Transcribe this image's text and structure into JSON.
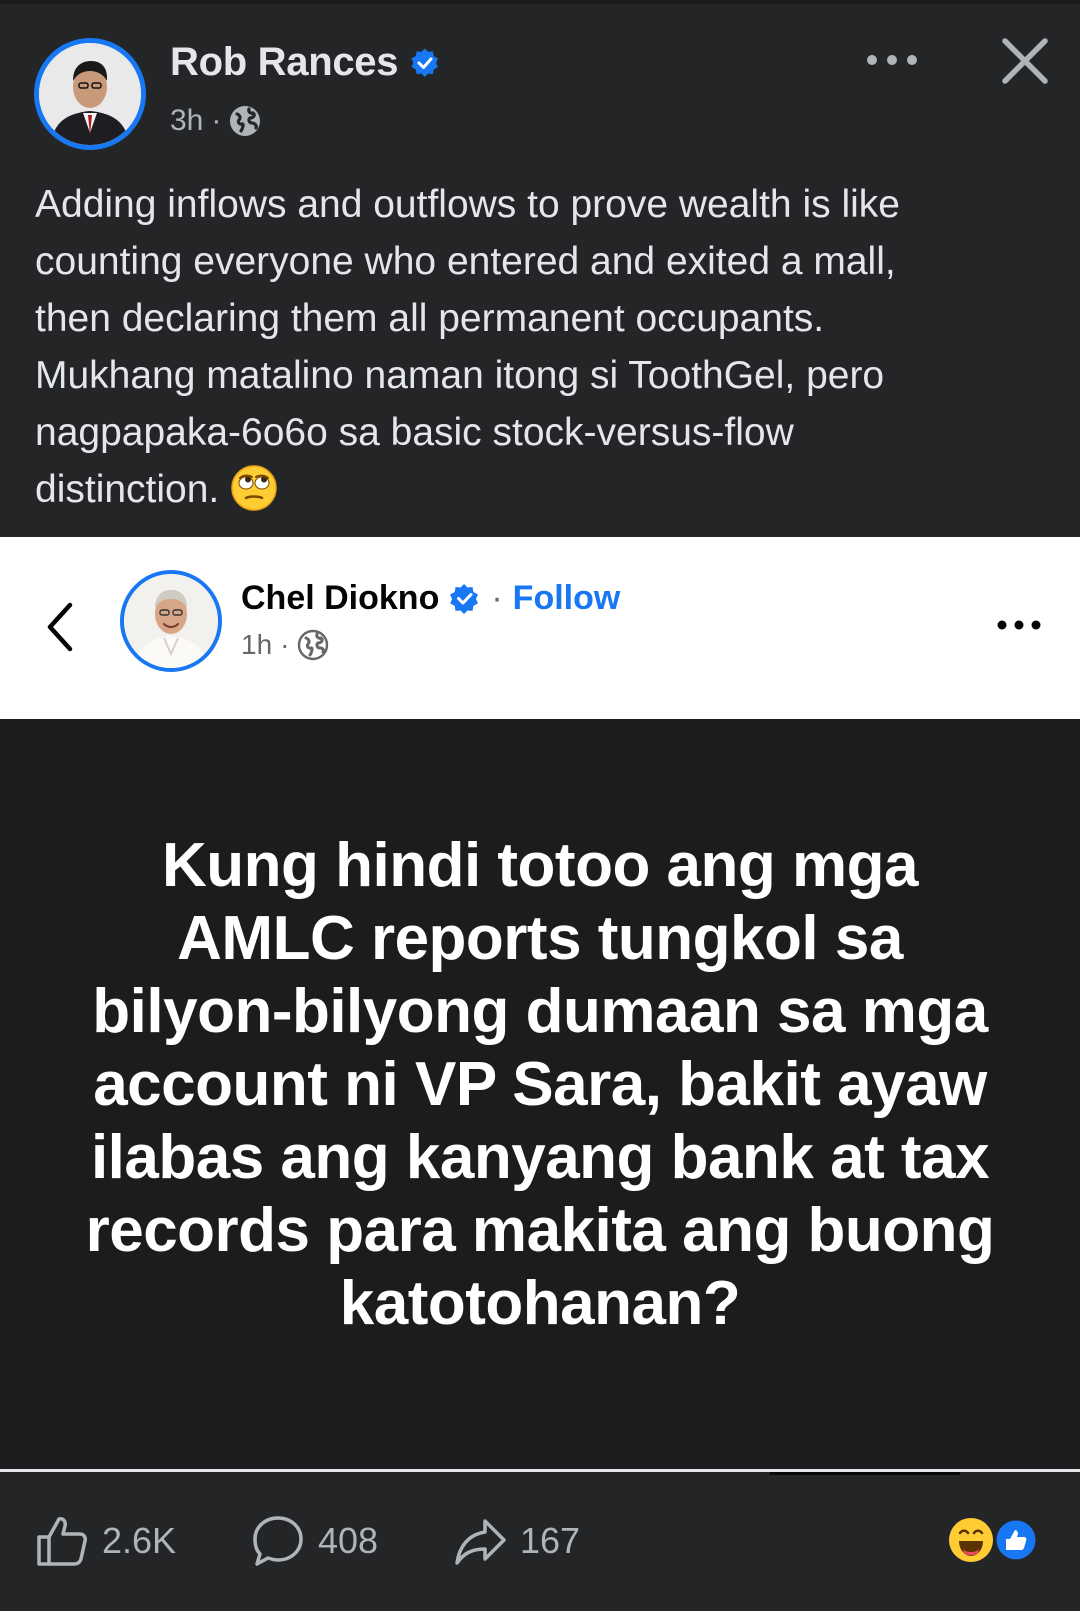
{
  "post": {
    "author": "Rob Rances",
    "time": "3h",
    "separator": "·",
    "text_lines": [
      "Adding inflows and outflows to prove wealth is like",
      "counting everyone who entered and exited a mall,",
      "then declaring them all permanent occupants.",
      "Mukhang matalino naman itong si ToothGel, pero",
      "nagpapaka-6o6o sa basic stock-versus-flow",
      "distinction."
    ]
  },
  "shared": {
    "author": "Chel Diokno",
    "separator": "·",
    "follow_label": "Follow",
    "time": "1h",
    "quote_lines": [
      "Kung hindi totoo ang mga",
      "AMLC reports tungkol sa",
      "bilyon-bilyong dumaan sa mga",
      "account ni VP Sara, bakit ayaw",
      "ilabas ang kanyang bank at tax",
      "records para makita ang buong",
      "katotohanan?"
    ]
  },
  "actions": {
    "likes": "2.6K",
    "comments": "408",
    "shares": "167"
  },
  "icons": {
    "more": "more-dots-icon",
    "close": "close-icon",
    "globe": "globe-icon",
    "verified": "verified-badge-icon",
    "back": "chevron-left-icon",
    "like": "thumbs-up-icon",
    "comment": "comment-bubble-icon",
    "share": "share-arrow-icon"
  },
  "colors": {
    "background": "#242526",
    "brand": "#1877f2",
    "text": "#e4e6eb",
    "muted": "#b0b3b8"
  }
}
